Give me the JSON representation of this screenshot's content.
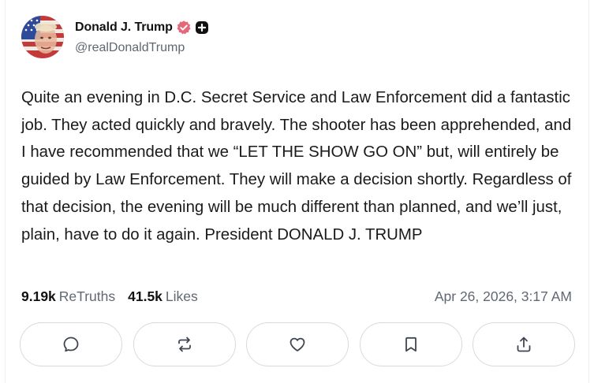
{
  "author": {
    "display_name": "Donald J. Trump",
    "handle": "@realDonaldTrump"
  },
  "post": {
    "text": "Quite an evening in D.C. Secret Service and Law Enforcement did a fantastic job. They acted quickly and bravely. The shooter has been apprehended, and I have recommended that we “LET THE SHOW GO ON” but, will entirely be guided by Law Enforcement. They will make a decision shortly. Regardless of that decision, the evening will be much different than planned, and we’ll just, plain, have to do it again. President DONALD J. TRUMP"
  },
  "stats": {
    "retruths_count": "9.19k",
    "retruths_label": "ReTruths",
    "likes_count": "41.5k",
    "likes_label": "Likes",
    "timestamp": "Apr 26, 2026, 3:17 AM"
  },
  "actions": [
    {
      "icon": "reply-icon"
    },
    {
      "icon": "retruth-icon"
    },
    {
      "icon": "like-icon"
    },
    {
      "icon": "bookmark-icon"
    },
    {
      "icon": "share-icon"
    }
  ],
  "colors": {
    "verified_badge": "#e4677a",
    "muted_text": "#606873",
    "button_border": "#d6dae0"
  }
}
